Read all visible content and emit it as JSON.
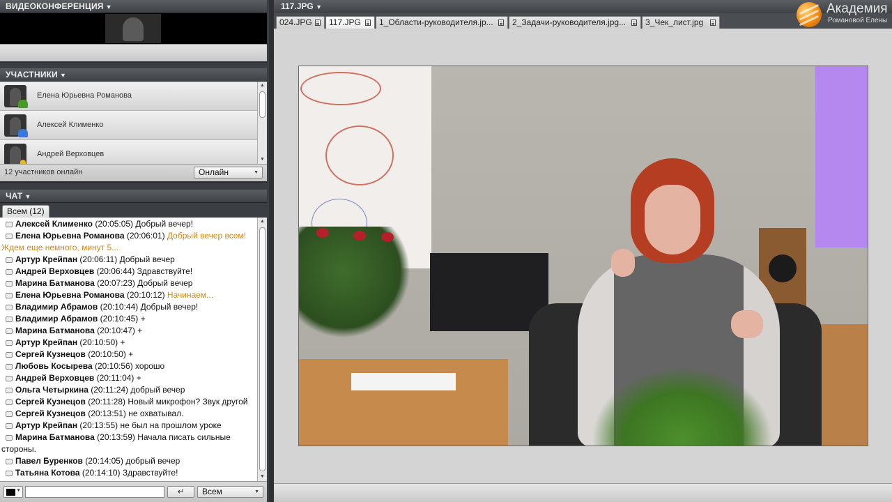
{
  "video": {
    "title": "ВИДЕОКОНФЕРЕНЦИЯ",
    "arrow": "▼"
  },
  "participants": {
    "title": "УЧАСТНИКИ",
    "arrow": "▼",
    "items": [
      {
        "name": "Елена Юрьевна Романова",
        "status_color": "#4a9a2a"
      },
      {
        "name": "Алексей Клименко",
        "status_color": "#3a78d8"
      },
      {
        "name": "Андрей Верховцев",
        "status_color": "#e8b820"
      }
    ],
    "online_count": "12 участников онлайн",
    "status_select": "Онлайн"
  },
  "chat": {
    "title": "ЧАТ",
    "arrow": "▼",
    "tab": "Всем (12)",
    "messages": [
      {
        "who": "Алексей Клименко",
        "time": " (20:05:05) ",
        "text": "Добрый вечер!",
        "hl": ""
      },
      {
        "who": "Елена Юрьевна Романова ",
        "time": " (20:06:01) ",
        "text": "",
        "hl": "Добрый вечер всем!"
      },
      {
        "who": "",
        "time": "",
        "text": "",
        "hl": "Ждем еще немного, минут 5..."
      },
      {
        "who": "Артур Крейпан",
        "time": " (20:06:11) ",
        "text": "Добрый вечер",
        "hl": ""
      },
      {
        "who": "Андрей Верховцев",
        "time": " (20:06:44) ",
        "text": "Здравствуйте!",
        "hl": ""
      },
      {
        "who": "Марина Батманова",
        "time": " (20:07:23) ",
        "text": "Добрый вечер",
        "hl": ""
      },
      {
        "who": "Елена Юрьевна Романова ",
        "time": " (20:10:12) ",
        "text": "",
        "hl": "Начинаем..."
      },
      {
        "who": "Владимир Абрамов",
        "time": " (20:10:44) ",
        "text": "Добрый вечер!",
        "hl": ""
      },
      {
        "who": "Владимир Абрамов",
        "time": " (20:10:45) ",
        "text": "+",
        "hl": ""
      },
      {
        "who": "Марина Батманова",
        "time": " (20:10:47) ",
        "text": "+",
        "hl": ""
      },
      {
        "who": "Артур Крейпан",
        "time": " (20:10:50) ",
        "text": "+",
        "hl": ""
      },
      {
        "who": "Сергей Кузнецов",
        "time": " (20:10:50) ",
        "text": "+",
        "hl": ""
      },
      {
        "who": "Любовь Косырева",
        "time": " (20:10:56) ",
        "text": "хорошо",
        "hl": ""
      },
      {
        "who": "Андрей Верховцев",
        "time": " (20:11:04) ",
        "text": "+",
        "hl": ""
      },
      {
        "who": "Ольга Четыркина",
        "time": " (20:11:24) ",
        "text": "добрый вечер",
        "hl": ""
      },
      {
        "who": "Сергей Кузнецов",
        "time": " (20:11:28) ",
        "text": "Новый микрофон? Звук другой",
        "hl": ""
      },
      {
        "who": "Сергей Кузнецов",
        "time": " (20:13:51) ",
        "text": "не охватывал.",
        "hl": ""
      },
      {
        "who": "Артур Крейпан",
        "time": " (20:13:55) ",
        "text": "не был на прошлом уроке",
        "hl": ""
      },
      {
        "who": "Марина Батманова",
        "time": " (20:13:59) ",
        "text": "Начала писать сильные",
        "hl": ""
      },
      {
        "who": "",
        "time": "",
        "text": "стороны.",
        "hl": ""
      },
      {
        "who": "Павел Буренков",
        "time": " (20:14:05) ",
        "text": "добрый вечер",
        "hl": ""
      },
      {
        "who": "Татьяна Котова",
        "time": " (20:14:10) ",
        "text": "Здравствуйте!",
        "hl": ""
      }
    ],
    "send_label": "↵",
    "recipient_select": "Всем"
  },
  "document": {
    "title": "117.JPG",
    "arrow": "▼",
    "tabs": [
      {
        "label": "024.JPG",
        "active": false
      },
      {
        "label": "117.JPG",
        "active": true
      },
      {
        "label": "1_Области-руководителя.jp...",
        "active": false
      },
      {
        "label": "2_Задачи-руководителя.jpg...",
        "active": false
      },
      {
        "label": "3_Чек_лист.jpg",
        "active": false
      }
    ]
  },
  "logo": {
    "title": "Академия",
    "subtitle": "Романовой Елены"
  },
  "colors": {
    "accent": "#d08a1c",
    "panel_dark": "#3a3d41"
  }
}
